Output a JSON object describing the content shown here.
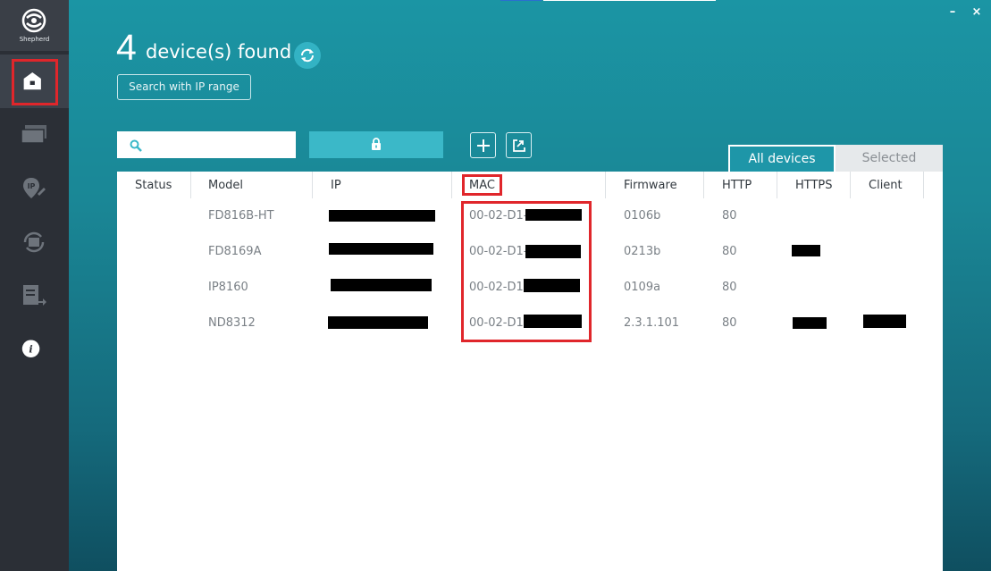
{
  "app": {
    "logo_text": "Shepherd",
    "accent_color": "#33b3c4",
    "highlight_color": "#e0262b"
  },
  "sidebar": {
    "items": [
      {
        "icon": "home-icon",
        "active": true
      },
      {
        "icon": "devices-icon"
      },
      {
        "icon": "ip-location-icon",
        "label": "IP"
      },
      {
        "icon": "sync-icon"
      },
      {
        "icon": "report-export-icon"
      },
      {
        "icon": "info-icon",
        "label": "i"
      }
    ]
  },
  "window": {
    "minimize_label": "–",
    "close_label": "×"
  },
  "header": {
    "count": "4",
    "found_label": "device(s) found",
    "ip_range_button": "Search with IP range"
  },
  "toolbar": {
    "search_placeholder": "",
    "lock_icon": "lock-icon",
    "add_icon": "plus-icon",
    "export_icon": "export-icon"
  },
  "tabs": [
    {
      "label": "All devices",
      "active": true
    },
    {
      "label": "Selected",
      "active": false
    }
  ],
  "table": {
    "columns": [
      "Status",
      "Model",
      "IP",
      "MAC",
      "Firmware",
      "HTTP",
      "HTTPS",
      "Client"
    ],
    "rows": [
      {
        "status": "",
        "model": "FD816B-HT",
        "ip": "",
        "mac": "00-02-D1-",
        "firmware": "0106b",
        "http": "80",
        "https": "",
        "client": ""
      },
      {
        "status": "",
        "model": "FD8169A",
        "ip": "",
        "mac": "00-02-D1-",
        "firmware": "0213b",
        "http": "80",
        "https": "",
        "client": ""
      },
      {
        "status": "",
        "model": "IP8160",
        "ip": "",
        "mac": "00-02-D1",
        "firmware": "0109a",
        "http": "80",
        "https": "",
        "client": ""
      },
      {
        "status": "",
        "model": "ND8312",
        "ip": "",
        "mac": "00-02-D1",
        "firmware": "2.3.1.101",
        "http": "80",
        "https": "",
        "client": ""
      }
    ]
  }
}
